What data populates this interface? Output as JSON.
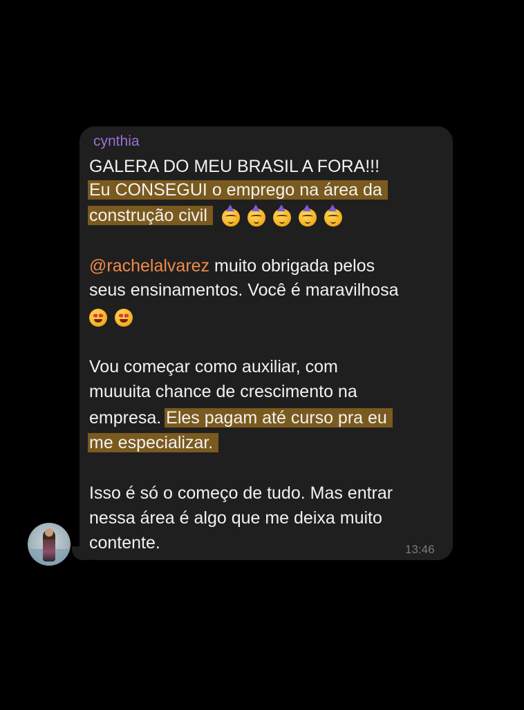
{
  "chat": {
    "sender": "cynthia",
    "time": "13:46",
    "lines": {
      "l1": "GALERA DO MEU BRASIL A FORA!!!",
      "l2": "Eu CONSEGUI o emprego na área da",
      "l3": "construção civil",
      "l4_mention": "@rachelalvarez",
      "l4_rest": " muito obrigada pelos",
      "l5": "seus ensinamentos. Você é maravilhosa",
      "l6": "Vou começar como auxiliar, com",
      "l7": "muuuita chance de crescimento na",
      "l8_plain": "empresa. ",
      "l8_hl": "Eles pagam até curso pra eu",
      "l9": "me especializar.",
      "l10": "Isso é só o começo de tudo. Mas entrar",
      "l11": "nessa área é algo que me deixa muito",
      "l12": "contente."
    },
    "emojis": {
      "party_row": [
        "partying-face",
        "partying-face",
        "partying-face",
        "partying-face",
        "partying-face"
      ],
      "star_row": [
        "star-struck-face",
        "star-struck-face"
      ]
    }
  },
  "colors": {
    "background": "#000000",
    "bubble": "#1f1f1f",
    "sender": "#9b6fd8",
    "mention": "#f08a4a",
    "highlight": "#7a5a1e",
    "text": "#f2f2f2",
    "time": "#7a7a7a"
  }
}
